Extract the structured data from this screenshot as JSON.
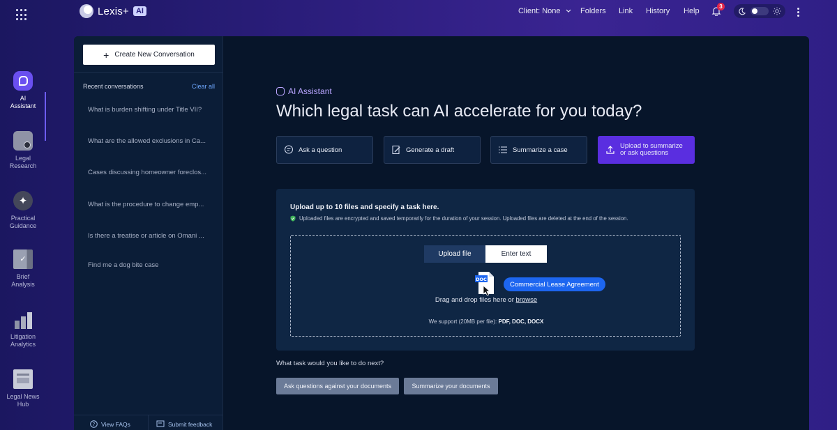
{
  "app": {
    "name": "Lexis+",
    "badge": "AI"
  },
  "topnav": {
    "client": "Client: None",
    "folders": "Folders",
    "link": "Link",
    "history": "History",
    "help": "Help",
    "notification_count": "3"
  },
  "rail": [
    {
      "label": "AI Assistant",
      "icon": "ai-assistant-icon",
      "active": true
    },
    {
      "label": "Legal Research",
      "icon": "legal-research-icon"
    },
    {
      "label": "Practical Guidance",
      "icon": "practical-guidance-icon"
    },
    {
      "label": "Brief Analysis",
      "icon": "brief-analysis-icon"
    },
    {
      "label": "Litigation Analytics",
      "icon": "litigation-analytics-icon"
    },
    {
      "label": "Legal News Hub",
      "icon": "legal-news-hub-icon"
    }
  ],
  "conversations": {
    "new_label": "Create New Conversation",
    "recent_label": "Recent conversations",
    "clear_label": "Clear all",
    "items": [
      "What is burden shifting under Title VII?",
      "What are the allowed exclusions in Ca...",
      "Cases discussing homeowner foreclos...",
      "What is the procedure to change emp...",
      "Is there a treatise or article on Omani ...",
      "Find me a dog bite case"
    ],
    "faq_label": "View FAQs",
    "feedback_label": "Submit feedback"
  },
  "main": {
    "assistant_label": "AI Assistant",
    "title": "Which legal task can AI accelerate for you today?",
    "tasks": [
      {
        "label": "Ask a question",
        "icon": "chat-bubble-icon"
      },
      {
        "label": "Generate a draft",
        "icon": "edit-document-icon"
      },
      {
        "label": "Summarize a case",
        "icon": "list-icon"
      },
      {
        "label": "Upload to summarize or ask questions",
        "icon": "upload-icon"
      }
    ]
  },
  "upload": {
    "heading": "Upload up to 10 files and specify a task here.",
    "note": "Uploaded files are encrypted and saved temporarily for the duration of your session. Uploaded files are deleted at the end of the session.",
    "tab_upload": "Upload file",
    "tab_text": "Enter text",
    "doc_badge": "DOC",
    "file_pill": "Commercial Lease Agreement",
    "drag_text": "Drag and drop files here or",
    "browse": "browse",
    "support_prefix": "We support (20MB per file):",
    "support_types": "PDF, DOC, DOCX"
  },
  "next": {
    "question": "What task would you like to do next?",
    "ask_label": "Ask questions against your documents",
    "summarize_label": "Summarize your documents"
  },
  "colors": {
    "accent": "#5a2ee0",
    "pill": "#1d66f0",
    "panel": "#0b1d37",
    "frame": "#07152a",
    "badge": "#e3264a"
  }
}
